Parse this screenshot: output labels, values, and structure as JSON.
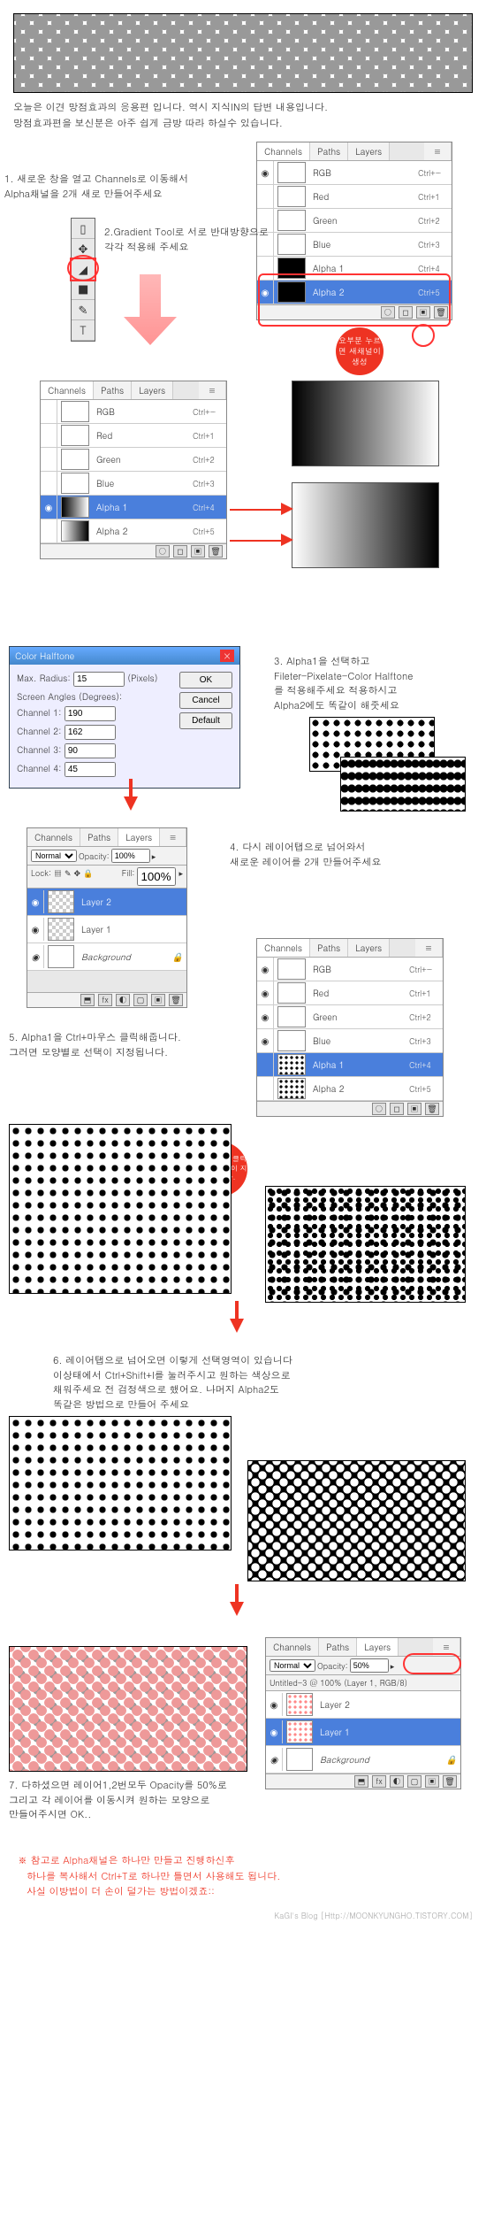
{
  "intro": {
    "line1": "오늘은 이견 망점효과의 응용편 입니다. 역시 지식IN의 답변 내용입니다.",
    "line2": "망점효과편을 보신분은 아주 쉽게 금방 따라 하실수 있습니다."
  },
  "steps": {
    "s1": "1. 새로운 창을 열고 Channels로 이동해서\nAlpha채널을 2개 새로 만들어주세요",
    "s2": "2.Gradient Tool로 서로 반대방향으로\n각각 적용해 주세요",
    "s3": "3. Alpha1을 선택하고\nFileter-Pixelate-Color Halftone\n를 적용해주세요 적용하시고\nAlpha2에도 똑같이 해줏세요",
    "s4": "4. 다시 레이어탭으로 넘어와서\n새로운 레이어를 2개 만들어주세요",
    "s5": "5. Alpha1을 Ctrl+마우스 클릭해줍니다.\n그러면 모양별로 선택이 지정됩니다.",
    "s6": "6. 레이어탭으로 넘어오면 이렇게 선택영역이 있습니다\n이상태에서 Ctrl+Shift+I를 눌러주시고 원하는 색상으로\n채워주세요 전 검정색으로 했어요. 나머지 Alpha2도\n똑같은 방법으로 만들어 주세요",
    "s7": "7. 다하셨으면 레이어1,2번모두 Opacity를 50%로\n그리고 각 레이어를 이동시켜 원하는 모양으로\n만들어주시면 OK..",
    "balloon1": "요부분\n누르면\n새채널이\n생성",
    "balloon2": "Ctrl+마우스 클릭\n하시면 영역이\n지정됩니다."
  },
  "panel": {
    "tabs": {
      "channels": "Channels",
      "paths": "Paths",
      "layers": "Layers"
    },
    "rgb": "RGB",
    "red": "Red",
    "green": "Green",
    "blue": "Blue",
    "alpha1": "Alpha 1",
    "alpha2": "Alpha 2",
    "keys": {
      "rgb": "Ctrl+~",
      "red": "Ctrl+1",
      "green": "Ctrl+2",
      "blue": "Ctrl+3",
      "a1": "Ctrl+4",
      "a2": "Ctrl+5"
    }
  },
  "toolbox": [
    "▯",
    "✥",
    "◢",
    "■",
    "✎",
    "T"
  ],
  "dialog": {
    "title": "Color Halftone",
    "maxRadiusLabel": "Max. Radius:",
    "maxRadius": "15",
    "pixels": "(Pixels)",
    "screenAngles": "Screen Angles (Degrees):",
    "ch1": "Channel 1:",
    "ch1v": "190",
    "ch2": "Channel 2:",
    "ch2v": "162",
    "ch3": "Channel 3:",
    "ch3v": "90",
    "ch4": "Channel 4:",
    "ch4v": "45",
    "ok": "OK",
    "cancel": "Cancel",
    "default": "Default"
  },
  "layers": {
    "normal": "Normal",
    "opacity": "Opacity:",
    "fill": "Fill:",
    "lock": "Lock:",
    "layer2": "Layer 2",
    "layer1": "Layer 1",
    "background": "Background",
    "doctitle": "Untitled-3 @ 100% (Layer 1, RGB/8)",
    "opacity100": "100%",
    "opacity50": "50%"
  },
  "footnote": {
    "line1": "※ 참고로 Alpha채널은 하나만 만들고 진행하신후",
    "line2": "하나를 복사해서 Ctrl+T로 하나만 틀면서 사용해도 됩니다.",
    "line3": "사실 이방법이 더 손이 덜가는 방법이겠죠::"
  },
  "credit": "KaGI's Blog [Http://MOONKYUNGHO.TISTORY.COM]"
}
